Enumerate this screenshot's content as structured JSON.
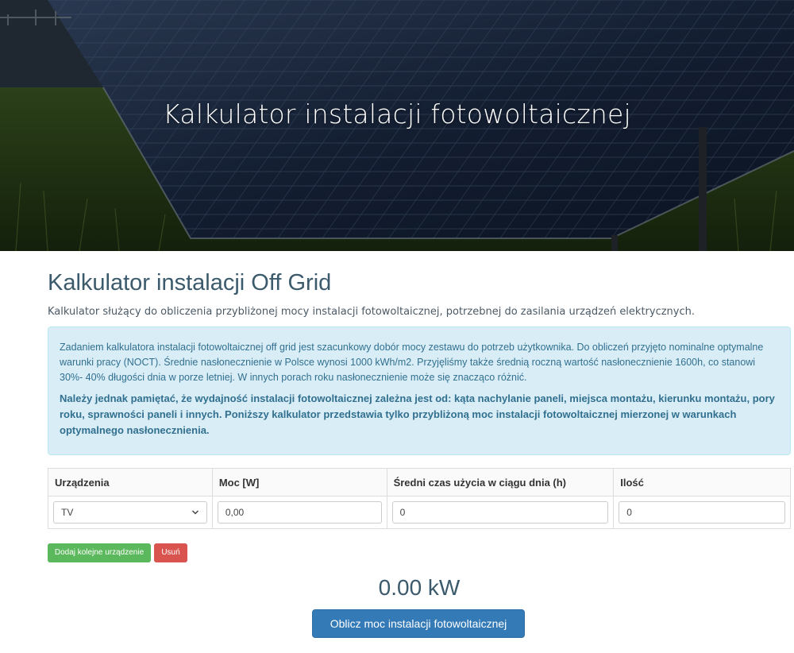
{
  "hero": {
    "title": "Kalkulator instalacji fotowoltaicznej"
  },
  "page": {
    "title": "Kalkulator instalacji Off Grid",
    "subtitle": "Kalkulator służący do obliczenia przybliżonej mocy instalacji fotowoltaicznej, potrzebnej do zasilania urządzeń elektrycznych."
  },
  "info": {
    "paragraph1": "Zadaniem kalkulatora instalacji fotowoltaicznej off grid jest szacunkowy dobór mocy zestawu do potrzeb użytkownika. Do obliczeń przyjęto nominalne optymalne warunki pracy (NOCT). Średnie nasłonecznienie w Polsce wynosi 1000 kWh/m2. Przyjęliśmy także średnią roczną wartość nasłonecznienie 1600h, co stanowi 30%- 40% długości dnia w porze letniej. W innych porach roku nasłonecznienie może się znacząco różnić.",
    "paragraph2": "Należy jednak pamiętać, że wydajność instalacji fotowoltaicznej zależna jest od: kąta nachylanie paneli, miejsca montażu, kierunku montażu, pory roku, sprawności paneli i innych. Poniższy kalkulator przedstawia tylko przybliżoną moc instalacji fotowoltaicznej mierzonej w warunkach optymalnego nasłonecznienia."
  },
  "table": {
    "headers": {
      "device": "Urządzenia",
      "power": "Moc [W]",
      "hours": "Średni czas użycia w ciągu dnia (h)",
      "quantity": "Ilość"
    },
    "row": {
      "device": "TV",
      "power": "0,00",
      "hours": "0",
      "quantity": "0"
    }
  },
  "buttons": {
    "add": "Dodaj kolejne urządzenie",
    "remove": "Usuń",
    "calculate": "Oblicz moc instalacji fotowoltaicznej"
  },
  "result": {
    "value": "0.00 kW"
  },
  "colors": {
    "primary": "#337ab7",
    "success": "#5cb85c",
    "danger": "#d9534f",
    "info_bg": "#d9edf7",
    "info_text": "#31708f",
    "heading": "#3b5a6b"
  }
}
